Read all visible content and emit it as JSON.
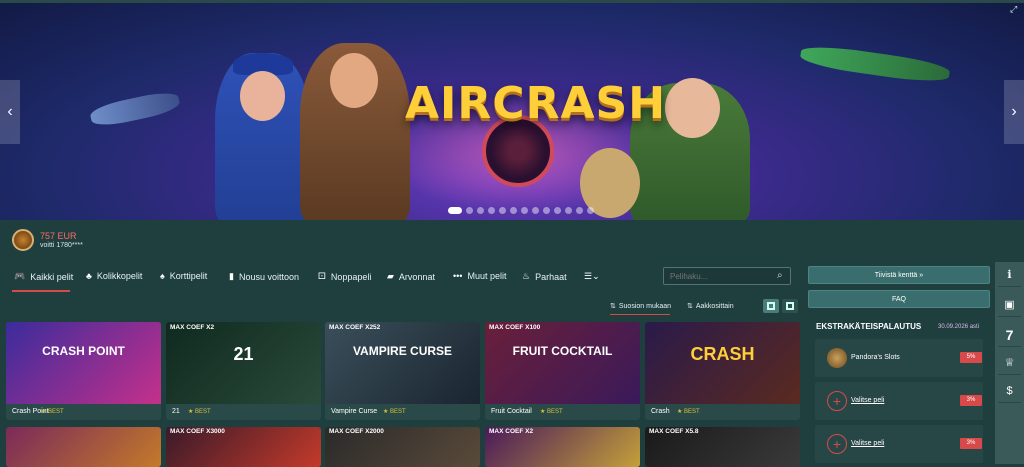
{
  "banner": {
    "title": "AIRCRASH",
    "slide_count": 13,
    "active_slide": 1,
    "prev_icon": "chevron-left-icon",
    "next_icon": "chevron-right-icon",
    "expand_icon": "expand-icon"
  },
  "winner": {
    "amount": "757 EUR",
    "user": "voitti 1780****"
  },
  "nav": {
    "items": [
      {
        "label": "Kaikki pelit",
        "icon": "gamepad-icon"
      },
      {
        "label": "Kolikkopelit",
        "icon": "slots-icon"
      },
      {
        "label": "Korttipelit",
        "icon": "spade-icon"
      },
      {
        "label": "Nousu voittoon",
        "icon": "chart-icon"
      },
      {
        "label": "Noppapeli",
        "icon": "dice-icon"
      },
      {
        "label": "Arvonnat",
        "icon": "ticket-icon"
      },
      {
        "label": "Muut pelit",
        "icon": "dots-icon"
      },
      {
        "label": "Parhaat",
        "icon": "fire-icon"
      }
    ],
    "more_icon": "menu-icon",
    "search_placeholder": "Pelihaku..."
  },
  "sort": {
    "popular": "Suosion mukaan",
    "alpha": "Aakkosittain"
  },
  "games_row1": [
    {
      "title": "Crash Point",
      "best": "BEST",
      "badge": "",
      "art": "CRASH POINT",
      "color1": "#3b2c9c",
      "color2": "#c4308a"
    },
    {
      "title": "21",
      "best": "BEST",
      "badge": "MAX COEF X2",
      "art": "21",
      "color1": "#0f2a1f",
      "color2": "#2a4a3a"
    },
    {
      "title": "Vampire Curse",
      "best": "BEST",
      "badge": "MAX COEF X252",
      "art": "VAMPIRE CURSE",
      "color1": "#3a4f5a",
      "color2": "#1a2530"
    },
    {
      "title": "Fruit Cocktail",
      "best": "BEST",
      "badge": "MAX COEF X100",
      "art": "FRUIT COCKTAIL",
      "color1": "#6a1f3a",
      "color2": "#3a1a5a"
    },
    {
      "title": "Crash",
      "best": "BEST",
      "badge": "",
      "art": "CRASH",
      "color1": "#2a1a4a",
      "color2": "#5a2a20"
    }
  ],
  "games_row2": [
    {
      "badge": "",
      "color1": "#7a2a5a",
      "color2": "#c47a2a"
    },
    {
      "badge": "MAX COEF X3000",
      "color1": "#3a1a2a",
      "color2": "#c43a2a"
    },
    {
      "badge": "MAX COEF X2000",
      "color1": "#2a2a2a",
      "color2": "#5a4a3a"
    },
    {
      "badge": "MAX COEF X2",
      "color1": "#4a1a5a",
      "color2": "#c4a03a"
    },
    {
      "badge": "MAX COEF X5.8",
      "color1": "#1a1a1a",
      "color2": "#3a3a3a"
    }
  ],
  "right": {
    "compact_label": "Tiivistä kenttä",
    "faq_label": "FAQ",
    "ek_title": "EKSTRAKÄTEISPALAUTUS",
    "ek_date": "30.09.2026 asti",
    "rows": [
      {
        "name": "Pandora's Slots",
        "pct": "5%",
        "type": "game"
      },
      {
        "name": "Valitse peli",
        "pct": "3%",
        "type": "choose"
      },
      {
        "name": "Valitse peli",
        "pct": "3%",
        "type": "choose"
      }
    ]
  },
  "side_icons": [
    {
      "icon": "info-icon",
      "glyph": "ℹ"
    },
    {
      "icon": "gift-icon",
      "glyph": "🎁"
    },
    {
      "icon": "seven-icon",
      "glyph": "7"
    },
    {
      "icon": "trophy-icon",
      "glyph": "♕"
    },
    {
      "icon": "dollar-icon",
      "glyph": "$"
    }
  ]
}
